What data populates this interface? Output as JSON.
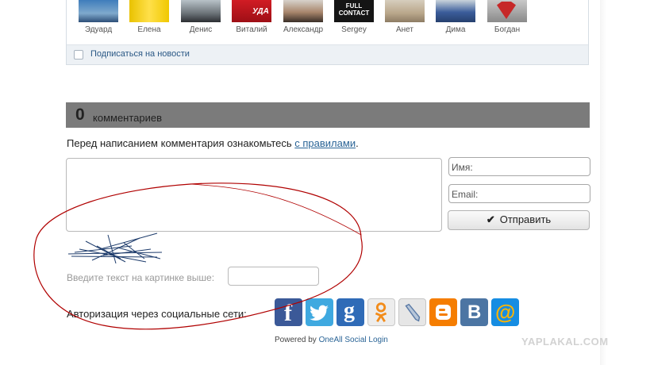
{
  "subscribers": {
    "items": [
      {
        "name": "Эдуард"
      },
      {
        "name": "Елена"
      },
      {
        "name": "Денис"
      },
      {
        "name": "Виталий",
        "caption": "УДА"
      },
      {
        "name": "Александр"
      },
      {
        "name": "Sergey",
        "caption": "FULL CONTACT"
      },
      {
        "name": "Анет"
      },
      {
        "name": "Дима"
      },
      {
        "name": "Богдан"
      }
    ],
    "subscribe_label": "Подписаться на новости"
  },
  "comments": {
    "count": "0",
    "label": "комментариев",
    "rules_prefix": "Перед написанием комментария ознакомьтесь ",
    "rules_link": "с правилами",
    "rules_suffix": "."
  },
  "form": {
    "name_placeholder": "Имя:",
    "email_placeholder": "Email:",
    "send_label": "Отправить",
    "captcha_label": "Введите текст на картинке выше:"
  },
  "social": {
    "label": "Авторизация через социальные сети:",
    "icons": [
      {
        "name": "facebook-icon",
        "glyph": "f",
        "color": "#3b5998"
      },
      {
        "name": "twitter-icon",
        "glyph": "🐦",
        "color": "#3fa9e0"
      },
      {
        "name": "google-icon",
        "glyph": "g",
        "color": "#2f6bb7"
      },
      {
        "name": "odnoklassniki-icon",
        "glyph": "ok",
        "color": "#e9e9e9"
      },
      {
        "name": "livejournal-icon",
        "glyph": "✎",
        "color": "#e6e6e6"
      },
      {
        "name": "blogger-icon",
        "glyph": "B",
        "color": "#f57d00"
      },
      {
        "name": "vkontakte-icon",
        "glyph": "B",
        "color": "#4c75a3"
      },
      {
        "name": "mailru-icon",
        "glyph": "@",
        "color": "#168de2"
      }
    ],
    "powered_prefix": "Powered by ",
    "powered_link": "OneAll Social Login"
  },
  "watermark": "YAPLAKAL.COM"
}
